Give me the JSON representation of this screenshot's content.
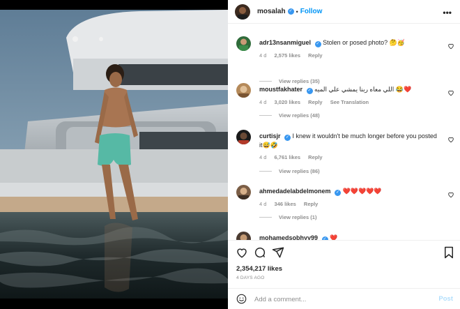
{
  "post": {
    "username": "mosalah",
    "follow_label": "Follow",
    "separator": "•",
    "more_label": "•••",
    "likes": "2,354,217 likes",
    "time_ago": "4 DAYS AGO"
  },
  "comments": [
    {
      "username": "adr13nsanmiguel",
      "text": "Stolen or posed photo? 🤔🥳",
      "age": "4 d",
      "likes": "2,575 likes",
      "reply_label": "Reply",
      "translation_label": "",
      "view_replies": "View replies (35)"
    },
    {
      "username": "moustfakhater",
      "text": "❤️😂 اللي معاه ربنا يمشي علي الميه",
      "age": "4 d",
      "likes": "3,020 likes",
      "reply_label": "Reply",
      "translation_label": "See Translation",
      "view_replies": "View replies (48)"
    },
    {
      "username": "curtisjr",
      "text": "I knew it wouldn't be much longer before you posted it😅🤣",
      "age": "4 d",
      "likes": "6,761 likes",
      "reply_label": "Reply",
      "translation_label": "",
      "view_replies": "View replies (86)"
    },
    {
      "username": "ahmedadelabdelmonem",
      "text": "❤️❤️❤️❤️❤️",
      "age": "4 d",
      "likes": "346 likes",
      "reply_label": "Reply",
      "translation_label": "",
      "view_replies": "View replies (1)"
    },
    {
      "username": "mohamedsobhyy99",
      "text": "❤️",
      "age": "",
      "likes": "",
      "reply_label": "",
      "translation_label": "",
      "view_replies": ""
    }
  ],
  "composer": {
    "placeholder": "Add a comment...",
    "post_label": "Post"
  },
  "icons": {
    "like": "heart-icon",
    "comment": "comment-icon",
    "share": "share-icon",
    "save": "bookmark-icon",
    "emoji": "emoji-icon",
    "verified": "verified-badge-icon",
    "more": "more-options-icon"
  },
  "colors": {
    "accent": "#0095f6",
    "verified": "#3897f0",
    "muted": "#8e8e8e",
    "post_disabled": "#b2dffc",
    "heart_red": "#e0245e"
  }
}
